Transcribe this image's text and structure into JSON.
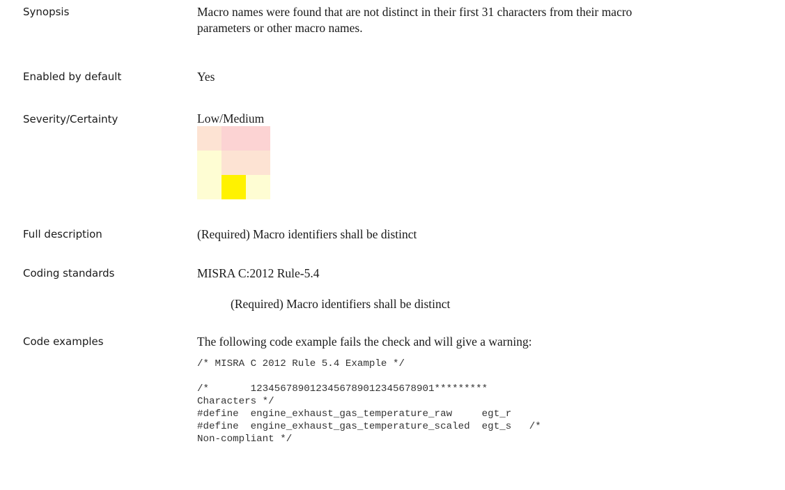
{
  "rows": {
    "synopsis": {
      "label": "Synopsis",
      "line1": "Macro names were found that are not distinct in their first 31 characters from their macro",
      "line2": "parameters or other macro names."
    },
    "enabled": {
      "label": "Enabled by default",
      "value": "Yes"
    },
    "severity": {
      "label": "Severity/Certainty",
      "value": "Low/Medium",
      "matrix": {
        "level": "Low/Medium",
        "colors": [
          [
            "#fde3d3",
            "#fcd3d3",
            "#fcd3d3"
          ],
          [
            "#fefdd3",
            "#fde3d3",
            "#fde3d3"
          ],
          [
            "#fefdd3",
            "#fff200",
            "#fefdd3"
          ]
        ]
      }
    },
    "full_description": {
      "label": "Full description",
      "value": "(Required) Macro identifiers shall be distinct"
    },
    "coding_standards": {
      "label": "Coding standards",
      "standard": "MISRA C:2012 Rule-5.4",
      "standard_desc": "(Required) Macro identifiers shall be distinct"
    },
    "code_examples": {
      "label": "Code examples",
      "intro": "The following code example fails the check and will give a warning:",
      "code_lines": [
        "/* MISRA C 2012 Rule 5.4 Example */",
        "",
        "/*       1234567890123456789012345678901*********",
        "Characters */",
        "#define  engine_exhaust_gas_temperature_raw     egt_r",
        "#define  engine_exhaust_gas_temperature_scaled  egt_s   /*",
        "Non-compliant */"
      ]
    }
  }
}
